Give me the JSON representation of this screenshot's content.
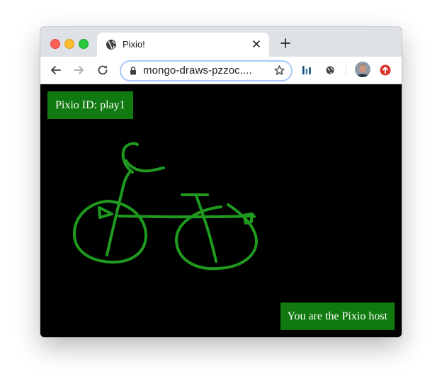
{
  "browser": {
    "tab_title": "Pixio!",
    "url": "mongo-draws-pzzoc....",
    "icons": [
      "globe-icon",
      "close-icon",
      "plus-icon",
      "back-arrow-icon",
      "forward-arrow-icon",
      "reload-icon",
      "lock-icon",
      "star-icon",
      "extension-bars-icon",
      "extension-globe-icon",
      "profile-avatar",
      "update-icon"
    ]
  },
  "app": {
    "pixio_id_label": "Pixio ID: play1",
    "host_label": "You are the Pixio host",
    "stroke_color": "#1f9a1f",
    "badge_color": "#107a10",
    "canvas_color": "#000000",
    "drawing_subject": "bicycle"
  }
}
